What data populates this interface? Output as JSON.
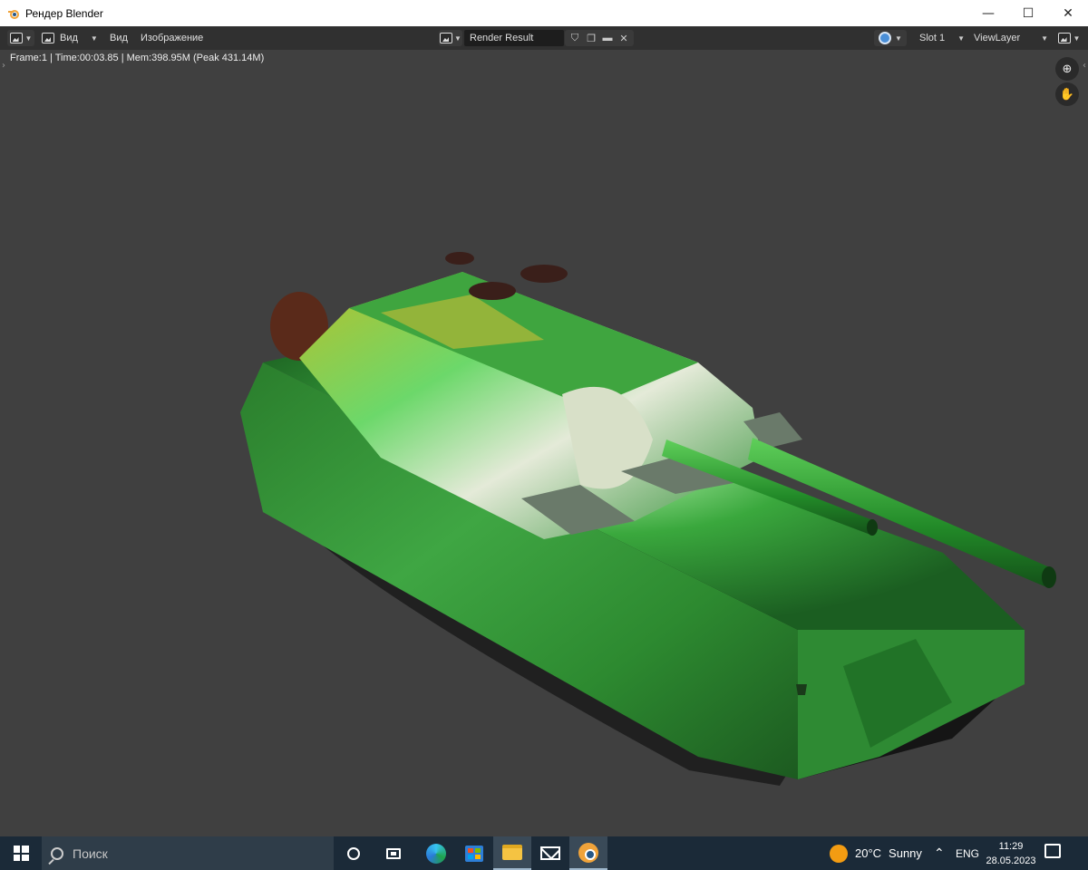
{
  "window": {
    "title": "Рендер Blender",
    "controls": [
      "—",
      "☐",
      "✕"
    ]
  },
  "header": {
    "view_label": "Вид",
    "menus": [
      "Вид",
      "Изображение"
    ],
    "image_name": "Render Result",
    "slot": "Slot 1",
    "view_layer": "ViewLayer"
  },
  "viewport": {
    "stats": "Frame:1 | Time:00:03.85 | Mem:398.95M (Peak 431.14M)"
  },
  "taskbar": {
    "search_placeholder": "Поиск",
    "weather_temp": "20°C",
    "weather_desc": "Sunny",
    "language": "ENG",
    "time": "11:29",
    "date": "28.05.2023"
  },
  "colors": {
    "titlebar": "#ffffff",
    "header": "#303030",
    "viewport_bg": "#404040",
    "taskbar": "#1b2a38",
    "camo_dark": "#1f7a2a",
    "camo_light": "#5fd86a",
    "camo_yellow": "#b7b52a"
  }
}
